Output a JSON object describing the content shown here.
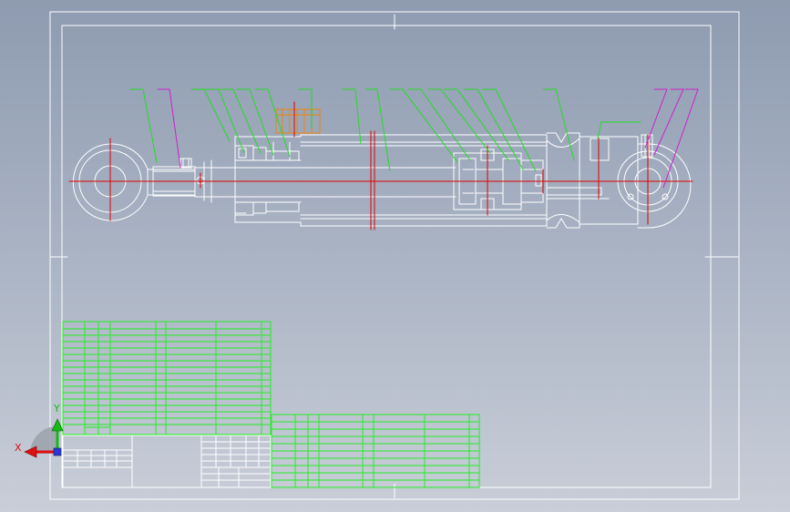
{
  "viewport": {
    "background_top": "#8e9bb0",
    "background_bottom": "#c9ced8"
  },
  "colors": {
    "outline": "#ffffff",
    "center_line": "#e00000",
    "leader_green": "#22dd22",
    "leader_magenta": "#cc22cc",
    "highlight_orange": "#e08a2a",
    "table_grid": "#22ee22",
    "axis_x": "#e01010",
    "axis_y": "#18b818",
    "axis_z": "#2a3ad0"
  },
  "axes": {
    "x_label": "X",
    "y_label": "Y"
  },
  "icons": {
    "coordinate_triad": "xyz-axis-triad-icon"
  },
  "drawing": {
    "subject": "hydraulic-cylinder-assembly",
    "green_leader_count": 14,
    "magenta_leader_count": 3,
    "parts_table_rows": 17,
    "secondary_table_rows": 10
  }
}
